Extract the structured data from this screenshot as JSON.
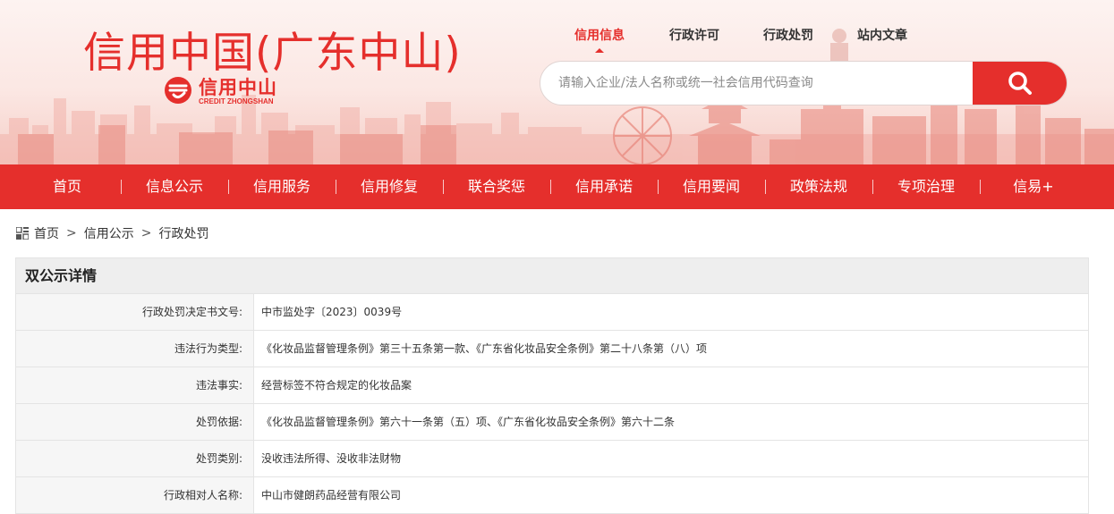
{
  "header": {
    "site_title": "信用中国(广东中山)",
    "logo_cn": "信用中山",
    "logo_en": "CREDIT ZHONGSHAN",
    "top_links": [
      {
        "label": "信用信息",
        "active": true
      },
      {
        "label": "行政许可",
        "active": false
      },
      {
        "label": "行政处罚",
        "active": false
      },
      {
        "label": "站内文章",
        "active": false
      }
    ],
    "search": {
      "placeholder": "请输入企业/法人名称或统一社会信用代码查询",
      "icon": "search-icon"
    }
  },
  "nav": {
    "items": [
      "首页",
      "信息公示",
      "信用服务",
      "信用修复",
      "联合奖惩",
      "信用承诺",
      "信用要闻",
      "政策法规",
      "专项治理",
      "信易+"
    ]
  },
  "breadcrumb": {
    "icon": "grid-icon",
    "items": [
      "首页",
      "信用公示",
      "行政处罚"
    ],
    "separator": ">"
  },
  "detail": {
    "title": "双公示详情",
    "rows": [
      {
        "label": "行政处罚决定书文号:",
        "value": "中市监处字〔2023〕0039号"
      },
      {
        "label": "违法行为类型:",
        "value": "《化妆品监督管理条例》第三十五条第一款、《广东省化妆品安全条例》第二十八条第（八）项"
      },
      {
        "label": "违法事实:",
        "value": "经营标签不符合规定的化妆品案"
      },
      {
        "label": "处罚依据:",
        "value": "《化妆品监督管理条例》第六十一条第（五）项、《广东省化妆品安全条例》第六十二条"
      },
      {
        "label": "处罚类别:",
        "value": "没收违法所得、没收非法财物"
      },
      {
        "label": "行政相对人名称:",
        "value": "中山市健朗药品经营有限公司"
      }
    ]
  },
  "colors": {
    "brand_red": "#e52f2c",
    "panel_header_bg": "#eeeeee",
    "label_bg": "#f6f6f6"
  }
}
